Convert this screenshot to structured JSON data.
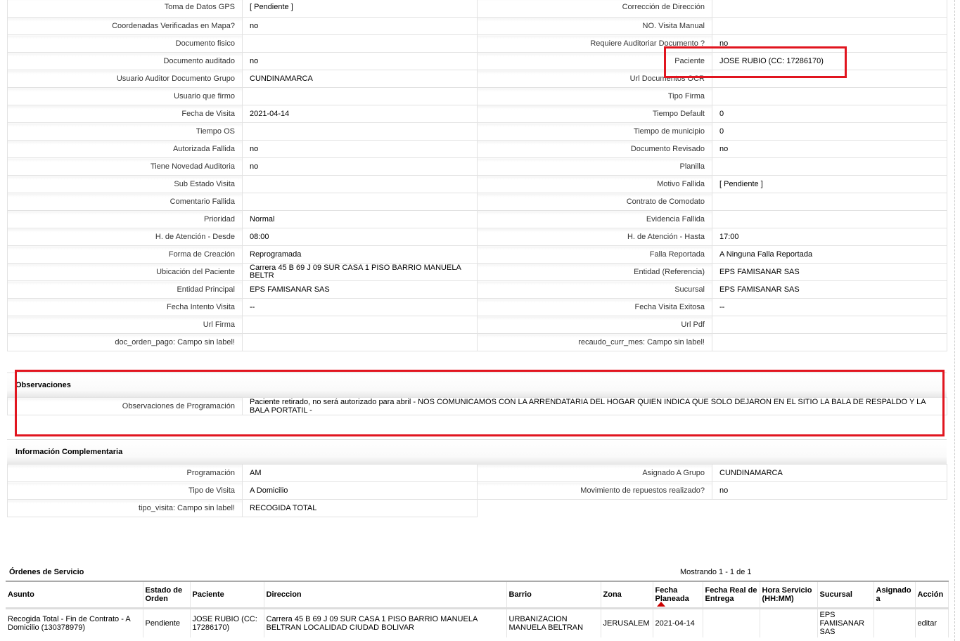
{
  "details": [
    [
      "Toma de Datos GPS",
      "[ Pendiente ]",
      "Corrección de Dirección",
      ""
    ],
    [
      "Coordenadas Verificadas en Mapa?",
      "no",
      "NO. Visita Manual",
      ""
    ],
    [
      "Documento fisico",
      "",
      "Requiere Auditoriar Documento ?",
      "no"
    ],
    [
      "Documento auditado",
      "no",
      "Paciente",
      "JOSE RUBIO (CC: 17286170)"
    ],
    [
      "Usuario Auditor Documento Grupo",
      "CUNDINAMARCA",
      "Url Documentos OCR",
      ""
    ],
    [
      "Usuario que firmo",
      "",
      "Tipo Firma",
      ""
    ],
    [
      "Fecha de Visita",
      "2021-04-14",
      "Tiempo Default",
      "0"
    ],
    [
      "Tiempo OS",
      "",
      "Tiempo de municipio",
      "0"
    ],
    [
      "Autorizada Fallida",
      "no",
      "Documento Revisado",
      "no"
    ],
    [
      "Tiene Novedad Auditoria",
      "no",
      "Planilla",
      ""
    ],
    [
      "Sub Estado Visita",
      "",
      "Motivo Fallida",
      "[ Pendiente ]"
    ],
    [
      "Comentario Fallida",
      "",
      "Contrato de Comodato",
      ""
    ],
    [
      "Prioridad",
      "Normal",
      "Evidencia Fallida",
      ""
    ],
    [
      "H. de Atención - Desde",
      "08:00",
      "H. de Atención - Hasta",
      "17:00"
    ],
    [
      "Forma de Creación",
      "Reprogramada",
      "Falla Reportada",
      "A Ninguna Falla Reportada"
    ],
    [
      "Ubicación del Paciente",
      "Carrera 45 B 69 J 09 SUR CASA 1 PISO BARRIO MANUELA BELTR",
      "Entidad (Referencia)",
      "EPS FAMISANAR SAS"
    ],
    [
      "Entidad Principal",
      "EPS FAMISANAR SAS",
      "Sucursal",
      "EPS FAMISANAR SAS"
    ],
    [
      "Fecha Intento Visita",
      "--",
      "Fecha Visita Exitosa",
      "--"
    ],
    [
      "Url Firma",
      "",
      "Url Pdf",
      ""
    ],
    [
      "doc_orden_pago: Campo sin label!",
      "",
      "recaudo_curr_mes: Campo sin label!",
      ""
    ]
  ],
  "observaciones": {
    "title": "Observaciones",
    "label": "Observaciones de Programación",
    "value": "Paciente retirado, no será autorizado para abril - NOS COMUNICAMOS CON LA ARRENDATARIA DEL HOGAR QUIEN INDICA QUE SOLO DEJARON EN EL SITIO LA BALA DE RESPALDO Y LA BALA PORTATIL -"
  },
  "complementaria": {
    "title": "Información Complementaria",
    "rows": [
      [
        "Programación",
        "AM",
        "Asignado A Grupo",
        "CUNDINAMARCA"
      ],
      [
        "Tipo de Visita",
        "A Domicilio",
        "Movimiento de repuestos realizado?",
        "no"
      ],
      [
        "tipo_visita: Campo sin label!",
        "RECOGIDA TOTAL"
      ]
    ]
  },
  "orders": {
    "title": "Órdenes de Servicio",
    "showing": "Mostrando 1 - 1 de 1",
    "headers": [
      "Asunto",
      "Estado de Orden",
      "Paciente",
      "Direccion",
      "Barrio",
      "Zona",
      "Fecha Planeada",
      "Fecha Real de Entrega",
      "Hora Servicio (HH:MM)",
      "Sucursal",
      "Asignado a",
      "Acción"
    ],
    "rows": [
      [
        "Recogida Total - Fin de Contrato - A Domicilio (130378979)",
        "Pendiente",
        "JOSE RUBIO (CC: 17286170)",
        "Carrera 45 B 69 J 09 SUR CASA 1 PISO BARRIO MANUELA BELTRAN LOCALIDAD CIUDAD BOLIVAR",
        "URBANIZACION MANUELA BELTRAN",
        "JERUSALEM",
        "2021-04-14",
        "",
        "",
        "EPS FAMISANAR SAS",
        "",
        "editar"
      ]
    ]
  },
  "colors": {
    "highlight": "#e1151f",
    "sort_arrow": "#cc0000"
  }
}
